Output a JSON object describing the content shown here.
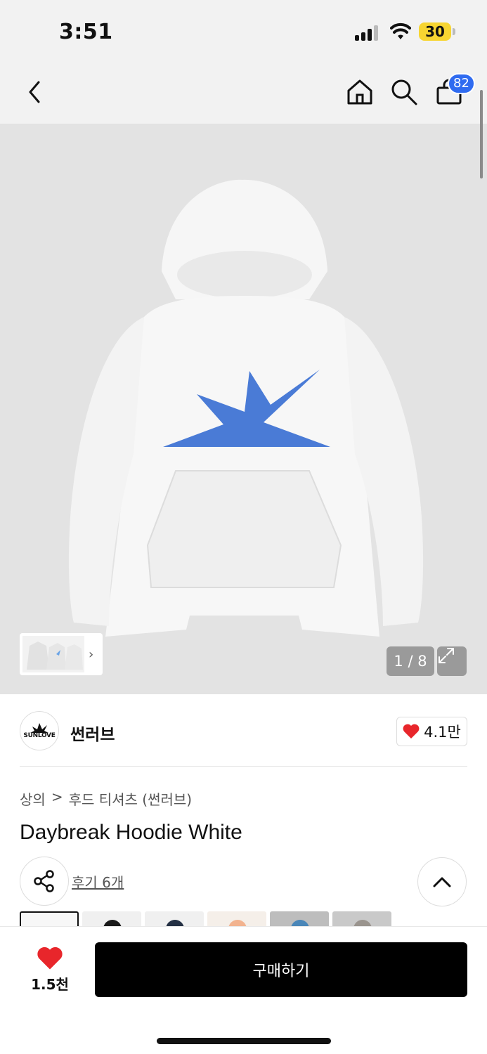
{
  "status_bar": {
    "time": "3:51",
    "battery": "30"
  },
  "nav": {
    "cart_count": "82",
    "icons": [
      "back-icon",
      "home-icon",
      "search-icon",
      "cart-icon"
    ]
  },
  "gallery": {
    "pager": "1 / 8",
    "thumb_chevron": "›"
  },
  "brand": {
    "name": "썬러브",
    "logo_text": "SUNLOVE",
    "likes": "4.1만"
  },
  "breadcrumb": {
    "category": "상의",
    "separator": ">",
    "subcategory": "후드 티셔츠 (썬러브)"
  },
  "product": {
    "title": "Daybreak Hoodie White",
    "reviews": "후기 6개"
  },
  "colors": {
    "accent": "#2f6bf0",
    "heart": "#e8262b",
    "graphic_blue": "#4a7bd6"
  },
  "bottom": {
    "wish_count": "1.5천",
    "buy_label": "구매하기"
  }
}
